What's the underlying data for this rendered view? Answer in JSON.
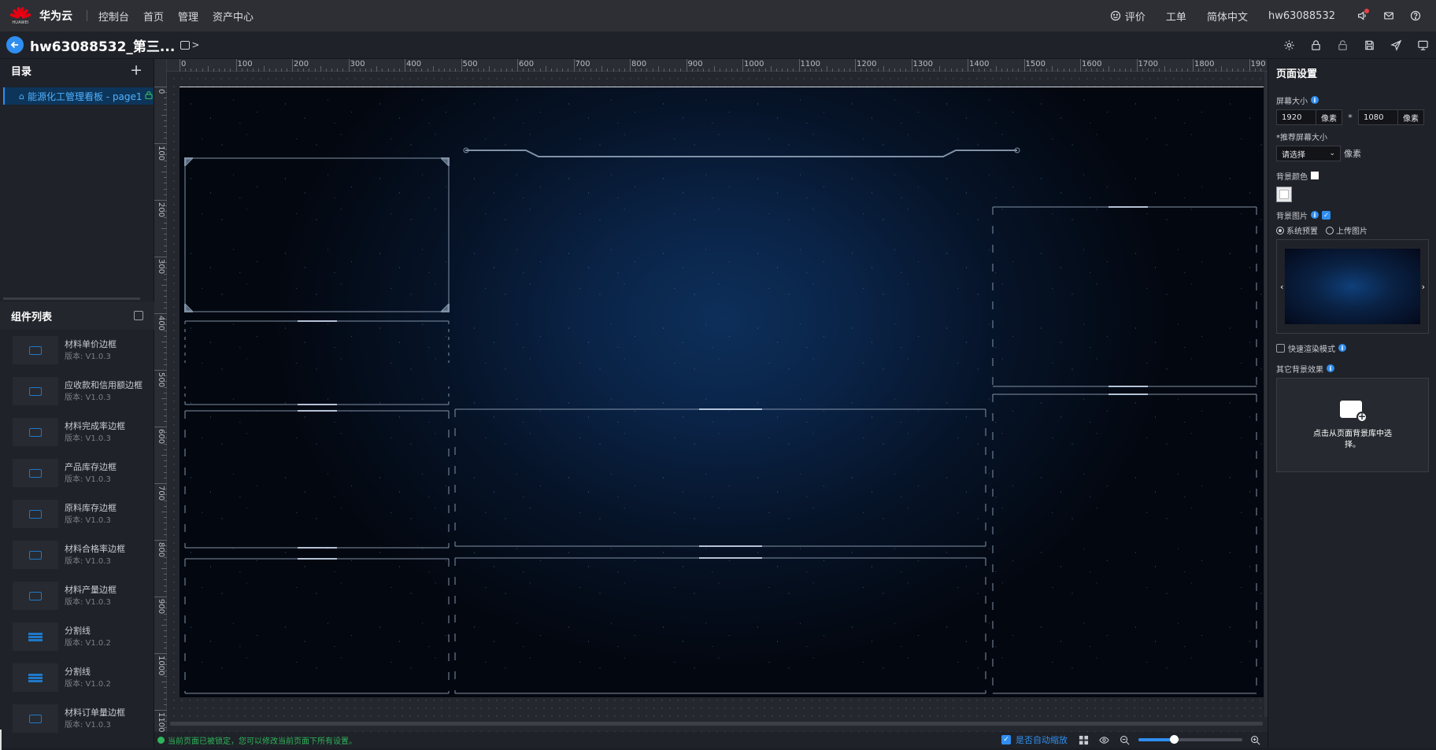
{
  "topnav": {
    "brand": "华为云",
    "logo_text": "HUAWEI",
    "links": [
      "控制台",
      "首页",
      "管理",
      "资产中心"
    ],
    "right_links": {
      "feedback": "评价",
      "ticket": "工单",
      "language": "简体中文",
      "user": "hw63088532"
    }
  },
  "titlebar": {
    "title": "hw63088532_第三...",
    "chevron": ">"
  },
  "sidebar": {
    "catalog_title": "目录",
    "add_label": "+",
    "page_item": "能源化工管理看板 - page1",
    "components_title": "组件列表",
    "components": [
      {
        "name": "材料单价边框",
        "version": "版本: V1.0.3",
        "kind": "frame"
      },
      {
        "name": "应收款和信用额边框",
        "version": "版本: V1.0.3",
        "kind": "frame"
      },
      {
        "name": "材料完成率边框",
        "version": "版本: V1.0.3",
        "kind": "frame"
      },
      {
        "name": "产品库存边框",
        "version": "版本: V1.0.3",
        "kind": "frame"
      },
      {
        "name": "原料库存边框",
        "version": "版本: V1.0.3",
        "kind": "frame"
      },
      {
        "name": "材料合格率边框",
        "version": "版本: V1.0.3",
        "kind": "frame"
      },
      {
        "name": "材料产量边框",
        "version": "版本: V1.0.3",
        "kind": "frame"
      },
      {
        "name": "分割线",
        "version": "版本: V1.0.2",
        "kind": "line"
      },
      {
        "name": "分割线",
        "version": "版本: V1.0.2",
        "kind": "line"
      },
      {
        "name": "材料订单量边框",
        "version": "版本: V1.0.3",
        "kind": "frame"
      }
    ]
  },
  "ruler": {
    "h_ticks": [
      "0",
      "100",
      "200",
      "300",
      "400",
      "500",
      "600",
      "700",
      "800",
      "900",
      "1000",
      "1100",
      "1200",
      "1300",
      "1400",
      "1500",
      "1600",
      "1700",
      "1800",
      "190"
    ],
    "v_ticks": [
      "0",
      "100",
      "200",
      "300",
      "400",
      "500",
      "600",
      "700",
      "800",
      "900",
      "1000",
      "1100"
    ]
  },
  "statusbar": {
    "message": "当前页面已被锁定，您可以修改当前页面下所有设置。",
    "autozoom_label": "是否自动缩放",
    "zoom_fraction": 0.34
  },
  "rpanel": {
    "title": "页面设置",
    "screen_size_label": "屏幕大小",
    "width": "1920",
    "height": "1080",
    "unit": "像素",
    "times": "*",
    "recommend_label": "*推荐屏幕大小",
    "recommend_placeholder": "请选择",
    "recommend_unit": "像素",
    "bg_color_label": "背景颜色",
    "bg_image_label": "背景图片",
    "radio_system": "系统预置",
    "radio_upload": "上传图片",
    "fast_render_label": "快速渲染模式",
    "other_bg_label": "其它背景效果",
    "upload_text": "点击从页面背景库中选择。",
    "prev": "‹",
    "next": "›"
  },
  "colors": {
    "accent": "#2f8ef0",
    "success": "#2fb45a",
    "logo": "#e60012"
  }
}
